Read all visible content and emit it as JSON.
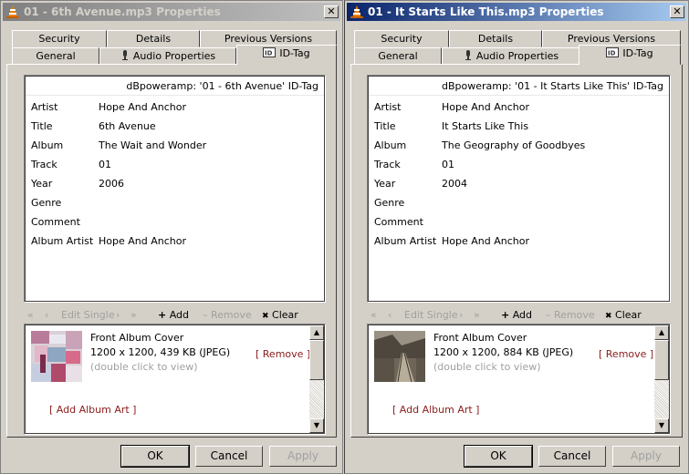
{
  "windows": [
    {
      "title": "01 - 6th Avenue.mp3 Properties",
      "active": false,
      "tabs_back": [
        "Security",
        "Details",
        "Previous Versions"
      ],
      "tabs_front": [
        "General",
        "Audio Properties",
        "ID-Tag"
      ],
      "selected_tab": "ID-Tag",
      "tag_header": "dBpoweramp: '01 - 6th Avenue' ID-Tag",
      "fields": [
        {
          "key": "Artist",
          "value": "Hope And Anchor"
        },
        {
          "key": "Title",
          "value": "6th Avenue"
        },
        {
          "key": "Album",
          "value": "The Wait and Wonder"
        },
        {
          "key": "Track",
          "value": "01"
        },
        {
          "key": "Year",
          "value": "2006"
        },
        {
          "key": "Genre",
          "value": ""
        },
        {
          "key": "Comment",
          "value": ""
        },
        {
          "key": "Album Artist",
          "value": "Hope And Anchor"
        }
      ],
      "toolbar": {
        "first": "«",
        "prev": "‹",
        "edit_single": "Edit Single",
        "next": "›",
        "last": "»",
        "add": "Add",
        "remove": "Remove",
        "clear": "Clear"
      },
      "art": {
        "title": "Front Album Cover",
        "info": "1200 x 1200, 439 KB  (JPEG)",
        "hint": "(double click to view)",
        "remove": "[ Remove ]",
        "add": "[ Add Album Art ]"
      },
      "buttons": {
        "ok": "OK",
        "cancel": "Cancel",
        "apply": "Apply"
      }
    },
    {
      "title": "01 - It Starts Like This.mp3 Properties",
      "active": true,
      "tabs_back": [
        "Security",
        "Details",
        "Previous Versions"
      ],
      "tabs_front": [
        "General",
        "Audio Properties",
        "ID-Tag"
      ],
      "selected_tab": "ID-Tag",
      "tag_header": "dBpoweramp: '01 - It Starts Like This' ID-Tag",
      "fields": [
        {
          "key": "Artist",
          "value": "Hope And Anchor"
        },
        {
          "key": "Title",
          "value": "It Starts Like This"
        },
        {
          "key": "Album",
          "value": "The Geography of Goodbyes"
        },
        {
          "key": "Track",
          "value": "01"
        },
        {
          "key": "Year",
          "value": "2004"
        },
        {
          "key": "Genre",
          "value": ""
        },
        {
          "key": "Comment",
          "value": ""
        },
        {
          "key": "Album Artist",
          "value": "Hope And Anchor"
        }
      ],
      "toolbar": {
        "first": "«",
        "prev": "‹",
        "edit_single": "Edit Single",
        "next": "›",
        "last": "»",
        "add": "Add",
        "remove": "Remove",
        "clear": "Clear"
      },
      "art": {
        "title": "Front Album Cover",
        "info": "1200 x 1200, 884 KB  (JPEG)",
        "hint": "(double click to view)",
        "remove": "[ Remove ]",
        "add": "[ Add Album Art ]"
      },
      "buttons": {
        "ok": "OK",
        "cancel": "Cancel",
        "apply": "Apply"
      }
    }
  ],
  "colors": {
    "title_active": "#0a246a",
    "title_inactive": "#808080",
    "link": "#8b1a1a",
    "dialog_bg": "#d4d0c8"
  },
  "icons": {
    "app": "vlc-cone-icon",
    "close": "close-icon",
    "audio": "speaker-icon",
    "idtag": "id-tag-icon"
  }
}
